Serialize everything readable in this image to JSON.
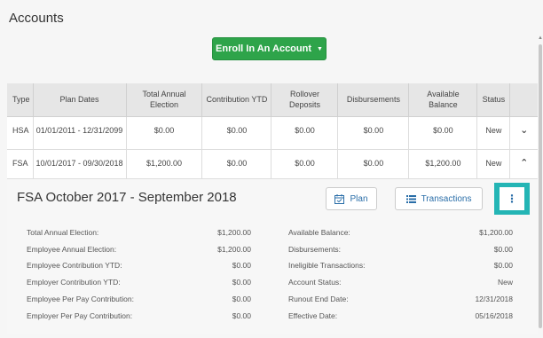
{
  "page": {
    "title": "Accounts"
  },
  "enroll": {
    "label": "Enroll In An Account"
  },
  "table": {
    "headers": [
      "Type",
      "Plan Dates",
      "Total Annual Election",
      "Contribution YTD",
      "Rollover Deposits",
      "Disbursements",
      "Available Balance",
      "Status"
    ],
    "rows": [
      {
        "type": "HSA",
        "dates": "01/01/2011 - 12/31/2099",
        "election": "$0.00",
        "ytd": "$0.00",
        "rollover": "$0.00",
        "disbursements": "$0.00",
        "balance": "$0.00",
        "status": "New",
        "toggle_icon": "chevron-down-icon"
      },
      {
        "type": "FSA",
        "dates": "10/01/2017 - 09/30/2018",
        "election": "$1,200.00",
        "ytd": "$0.00",
        "rollover": "$0.00",
        "disbursements": "$0.00",
        "balance": "$1,200.00",
        "status": "New",
        "toggle_icon": "chevron-up-icon"
      }
    ]
  },
  "details": {
    "title": "FSA October 2017 - September 2018",
    "plan_label": "Plan",
    "transactions_label": "Transactions",
    "more_icon": "vertical-dots-icon",
    "left": [
      {
        "label": "Total Annual Election:",
        "value": "$1,200.00"
      },
      {
        "label": "Employee Annual Election:",
        "value": "$1,200.00"
      },
      {
        "label": "Employee Contribution YTD:",
        "value": "$0.00"
      },
      {
        "label": "Employer Contribution YTD:",
        "value": "$0.00"
      },
      {
        "label": "Employee Per Pay Contribution:",
        "value": "$0.00"
      },
      {
        "label": "Employer Per Pay Contribution:",
        "value": "$0.00"
      }
    ],
    "right": [
      {
        "label": "Available Balance:",
        "value": "$1,200.00"
      },
      {
        "label": "Disbursements:",
        "value": "$0.00"
      },
      {
        "label": "Ineligible Transactions:",
        "value": "$0.00"
      },
      {
        "label": "Account Status:",
        "value": "New"
      },
      {
        "label": "Runout End Date:",
        "value": "12/31/2018"
      },
      {
        "label": "Effective Date:",
        "value": "05/16/2018"
      }
    ]
  },
  "colors": {
    "accent_green": "#2ea44a",
    "highlight_teal": "#24b5b5",
    "link_blue": "#2a6ea8"
  }
}
